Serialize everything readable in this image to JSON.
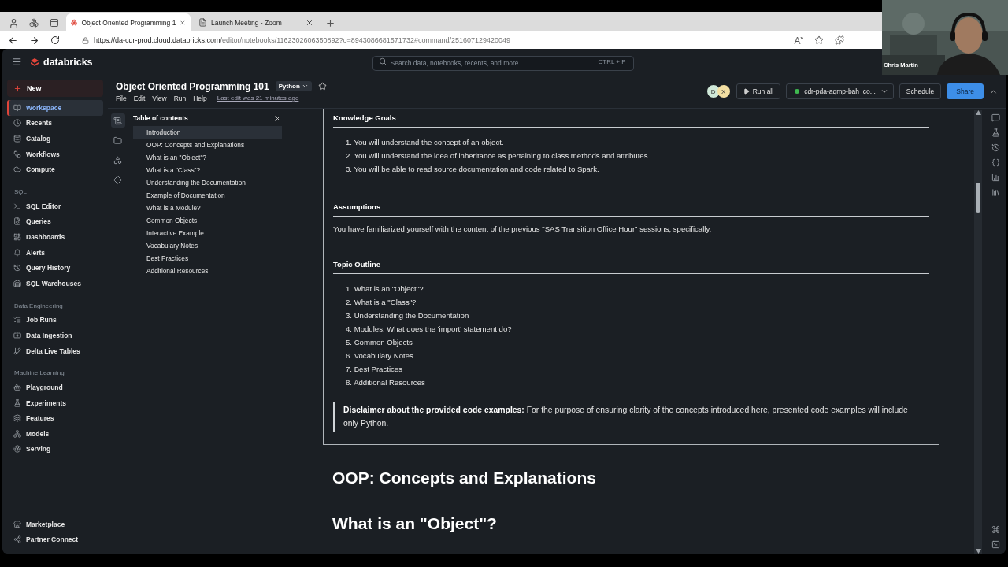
{
  "browser": {
    "tabs": [
      {
        "title": "Object Oriented Programming 1",
        "selected": true
      },
      {
        "title": "Launch Meeting - Zoom",
        "selected": false
      }
    ],
    "url_host": "https://da-cdr-prod.cloud.databricks.com",
    "url_path": "/editor/notebooks/1162302606350892?o=8943086681571732#command/251607129420049"
  },
  "app_header": {
    "brand": "databricks",
    "search_placeholder": "Search data, notebooks, recents, and more...",
    "shortcut": "CTRL + P"
  },
  "sidebar": {
    "new_button": "New",
    "sections": [
      {
        "items": [
          {
            "label": "Workspace",
            "selected": true
          },
          {
            "label": "Recents",
            "selected": false
          },
          {
            "label": "Catalog",
            "selected": false
          },
          {
            "label": "Workflows",
            "selected": false
          },
          {
            "label": "Compute",
            "selected": false
          }
        ]
      },
      {
        "title": "SQL",
        "items": [
          {
            "label": "SQL Editor",
            "selected": false
          },
          {
            "label": "Queries",
            "selected": false
          },
          {
            "label": "Dashboards",
            "selected": false
          },
          {
            "label": "Alerts",
            "selected": false
          },
          {
            "label": "Query History",
            "selected": false
          },
          {
            "label": "SQL Warehouses",
            "selected": false
          }
        ]
      },
      {
        "title": "Data Engineering",
        "items": [
          {
            "label": "Job Runs",
            "selected": false
          },
          {
            "label": "Data Ingestion",
            "selected": false
          },
          {
            "label": "Delta Live Tables",
            "selected": false
          }
        ]
      },
      {
        "title": "Machine Learning",
        "items": [
          {
            "label": "Playground",
            "selected": false
          },
          {
            "label": "Experiments",
            "selected": false
          },
          {
            "label": "Features",
            "selected": false
          },
          {
            "label": "Models",
            "selected": false
          },
          {
            "label": "Serving",
            "selected": false
          }
        ]
      }
    ],
    "footer": [
      {
        "label": "Marketplace",
        "selected": false
      },
      {
        "label": "Partner Connect",
        "selected": false
      }
    ]
  },
  "notebook": {
    "title": "Object Oriented Programming 101",
    "language": "Python",
    "menus": [
      "File",
      "Edit",
      "View",
      "Run",
      "Help"
    ],
    "last_edit": "Last edit was 21 minutes ago",
    "avatars": [
      {
        "initial": "D",
        "color": "#cfe8d8"
      },
      {
        "initial": "X",
        "color": "#f3dfa2"
      }
    ],
    "run_all": "Run all",
    "cluster": "cdr-pda-aqmp-bah_co...",
    "schedule": "Schedule",
    "share": "Share"
  },
  "toc": {
    "title": "Table of contents",
    "items": [
      {
        "label": "Introduction",
        "selected": true
      },
      {
        "label": "OOP: Concepts and Explanations",
        "selected": false
      },
      {
        "label": "What is an \"Object\"?",
        "selected": false
      },
      {
        "label": "What is a \"Class\"?",
        "selected": false
      },
      {
        "label": "Understanding the Documentation",
        "selected": false
      },
      {
        "label": "Example of Documentation",
        "selected": false
      },
      {
        "label": "What is a Module?",
        "selected": false
      },
      {
        "label": "Common Objects",
        "selected": false
      },
      {
        "label": "Interactive Example",
        "selected": false
      },
      {
        "label": "Vocabulary Notes",
        "selected": false
      },
      {
        "label": "Best Practices",
        "selected": false
      },
      {
        "label": "Additional Resources",
        "selected": false
      }
    ]
  },
  "cell": {
    "sections": [
      {
        "heading": "Knowledge Goals",
        "list": [
          "1. You will understand the concept of an object.",
          "2. You will understand the idea of inheritance as pertaining to class methods and attributes.",
          "3. You will be able to read source documentation and code related to Spark."
        ]
      },
      {
        "heading": "Assumptions",
        "paragraph": "You have familiarized yourself with the content of the previous \"SAS Transition Office Hour\" sessions, specifically."
      },
      {
        "heading": "Topic Outline",
        "list": [
          "1. What is an \"Object\"?",
          "2. What is a \"Class\"?",
          "3. Understanding the Documentation",
          "4. Modules: What does the 'import' statement do?",
          "5. Common Objects",
          "6. Vocabulary Notes",
          "7. Best Practices",
          "8. Additional Resources"
        ]
      }
    ],
    "disclaimer": "**Disclaimer about the provided code examples:** For the purpose of ensuring clarity of the concepts introduced here, presented code examples will include only Python."
  },
  "headings": [
    "OOP: Concepts and Explanations",
    "What is an \"Object\"?"
  ],
  "webcam": {
    "name": "Chris Martin"
  }
}
